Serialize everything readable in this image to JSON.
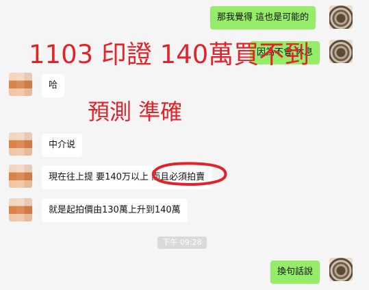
{
  "messages": [
    {
      "side": "right",
      "text": "那我覺得 這也是可能的"
    },
    {
      "side": "right",
      "text": "因為不會 休息"
    },
    {
      "side": "left",
      "text": "哈"
    },
    {
      "side": "left",
      "text": "中介说"
    },
    {
      "side": "left",
      "text": "現在往上提 要140万以上 而且必須拍賣"
    },
    {
      "side": "left",
      "text": "就是起拍價由130萬上升到140萬"
    },
    {
      "side": "right",
      "text": "換句話說"
    }
  ],
  "timestamp": "下午 09:28",
  "annotations": {
    "line1": "1103 印證 140萬買不到",
    "line2": "預測 準確"
  },
  "colors": {
    "background": "#f5f5f5",
    "incoming_bubble": "#ffffff",
    "outgoing_bubble": "#95ec69",
    "annotation_red": "#e2242a"
  }
}
